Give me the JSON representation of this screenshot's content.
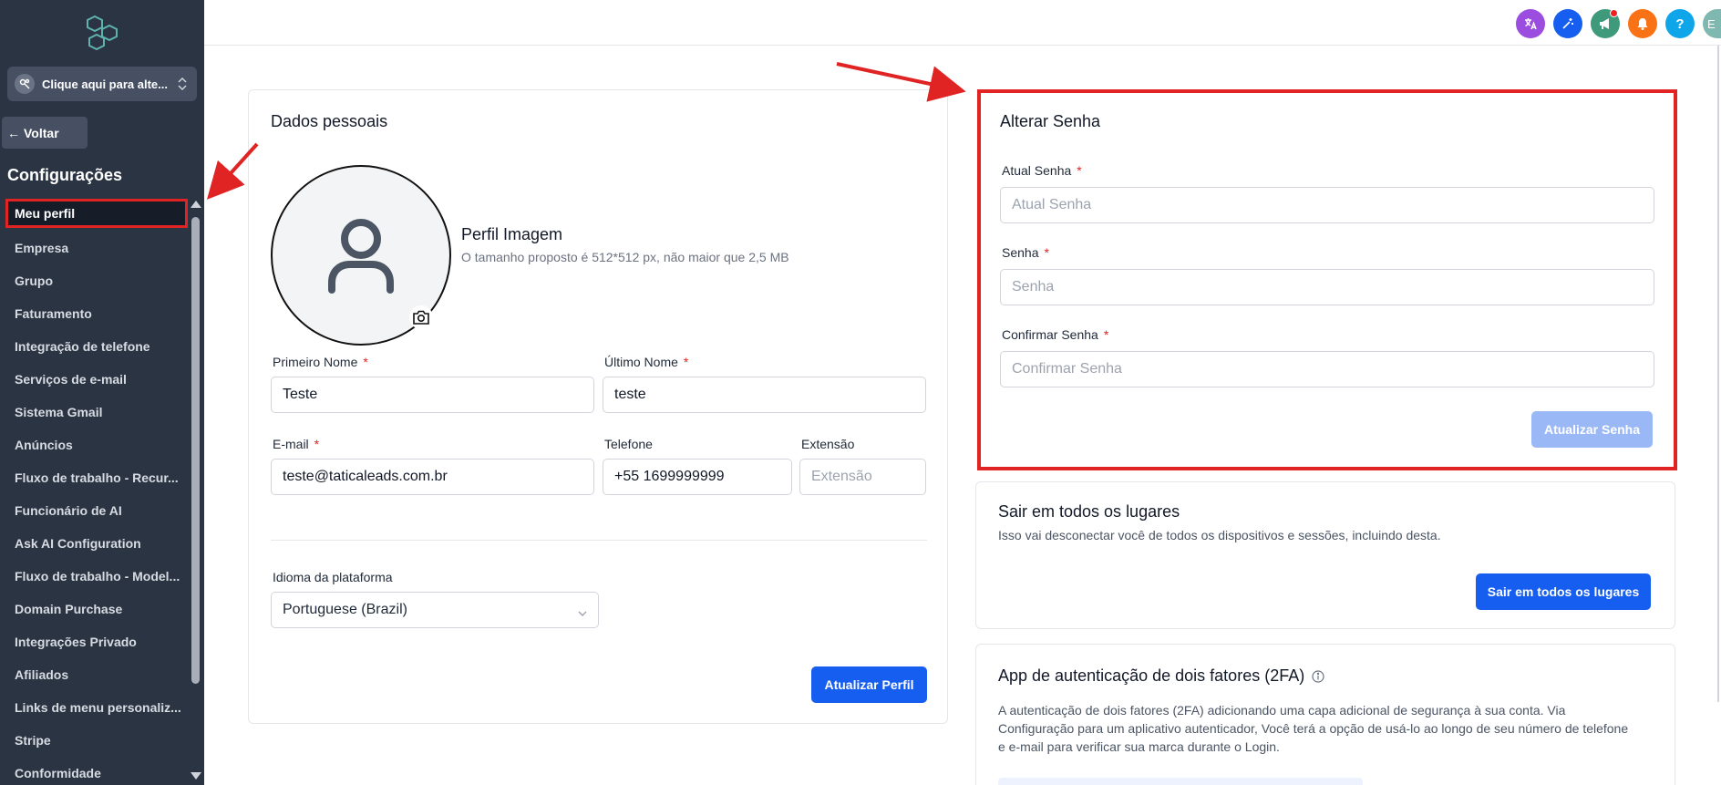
{
  "sidebar": {
    "switcher_label": "Clique aqui para alte...",
    "back_label": "Voltar",
    "section_title": "Configurações",
    "items": [
      {
        "label": "Meu perfil"
      },
      {
        "label": "Empresa"
      },
      {
        "label": "Grupo"
      },
      {
        "label": "Faturamento"
      },
      {
        "label": "Integração de telefone"
      },
      {
        "label": "Serviços de e-mail"
      },
      {
        "label": "Sistema Gmail"
      },
      {
        "label": "Anúncios"
      },
      {
        "label": "Fluxo de trabalho - Recur..."
      },
      {
        "label": "Funcionário de AI"
      },
      {
        "label": "Ask AI Configuration"
      },
      {
        "label": "Fluxo de trabalho - Model..."
      },
      {
        "label": "Domain Purchase"
      },
      {
        "label": "Integrações Privado"
      },
      {
        "label": "Afiliados"
      },
      {
        "label": "Links de menu personaliz..."
      },
      {
        "label": "Stripe"
      },
      {
        "label": "Conformidade"
      }
    ]
  },
  "topbar": {
    "icons": [
      {
        "name": "translate-icon",
        "color": "#9b4de0"
      },
      {
        "name": "magic-wand-icon",
        "color": "#155eef"
      },
      {
        "name": "megaphone-icon",
        "color": "#3f9a7c"
      },
      {
        "name": "bell-icon",
        "color": "#f97316"
      },
      {
        "name": "help-icon",
        "color": "#0ea5e9",
        "glyph": "?"
      }
    ],
    "avatar_initial": "E"
  },
  "personal": {
    "title": "Dados pessoais",
    "image_title": "Perfil Imagem",
    "image_hint": "O tamanho proposto é 512*512 px, não maior que 2,5 MB",
    "first_name_label": "Primeiro Nome",
    "first_name_value": "Teste",
    "last_name_label": "Último Nome",
    "last_name_value": "teste",
    "email_label": "E-mail",
    "email_value": "teste@taticaleads.com.br",
    "phone_label": "Telefone",
    "phone_value": "+55 1699999999",
    "ext_label": "Extensão",
    "ext_placeholder": "Extensão",
    "lang_label": "Idioma da plataforma",
    "lang_value": "Portuguese (Brazil)",
    "update_button": "Atualizar Perfil",
    "required_mark": "*"
  },
  "password": {
    "title": "Alterar Senha",
    "current_label": "Atual Senha",
    "current_placeholder": "Atual Senha",
    "new_label": "Senha",
    "new_placeholder": "Senha",
    "confirm_label": "Confirmar Senha",
    "confirm_placeholder": "Confirmar Senha",
    "update_button": "Atualizar Senha"
  },
  "logout": {
    "title": "Sair em todos os lugares",
    "description": "Isso vai desconectar você de todos os dispositivos e sessões, incluindo desta.",
    "button": "Sair em todos os lugares"
  },
  "tfa": {
    "title": "App de autenticação de dois fatores (2FA)",
    "description": "A autenticação de dois fatores (2FA) adicionando uma capa adicional de segurança à sua conta. Via Configuração para um aplicativo autenticador, Você terá a opção de usá-lo ao longo de seu número de telefone e e-mail para verificar sua marca durante o Login."
  },
  "colors": {
    "sidebar_bg": "#2b3442",
    "primary": "#155eef",
    "annotation_red": "#e02424"
  }
}
